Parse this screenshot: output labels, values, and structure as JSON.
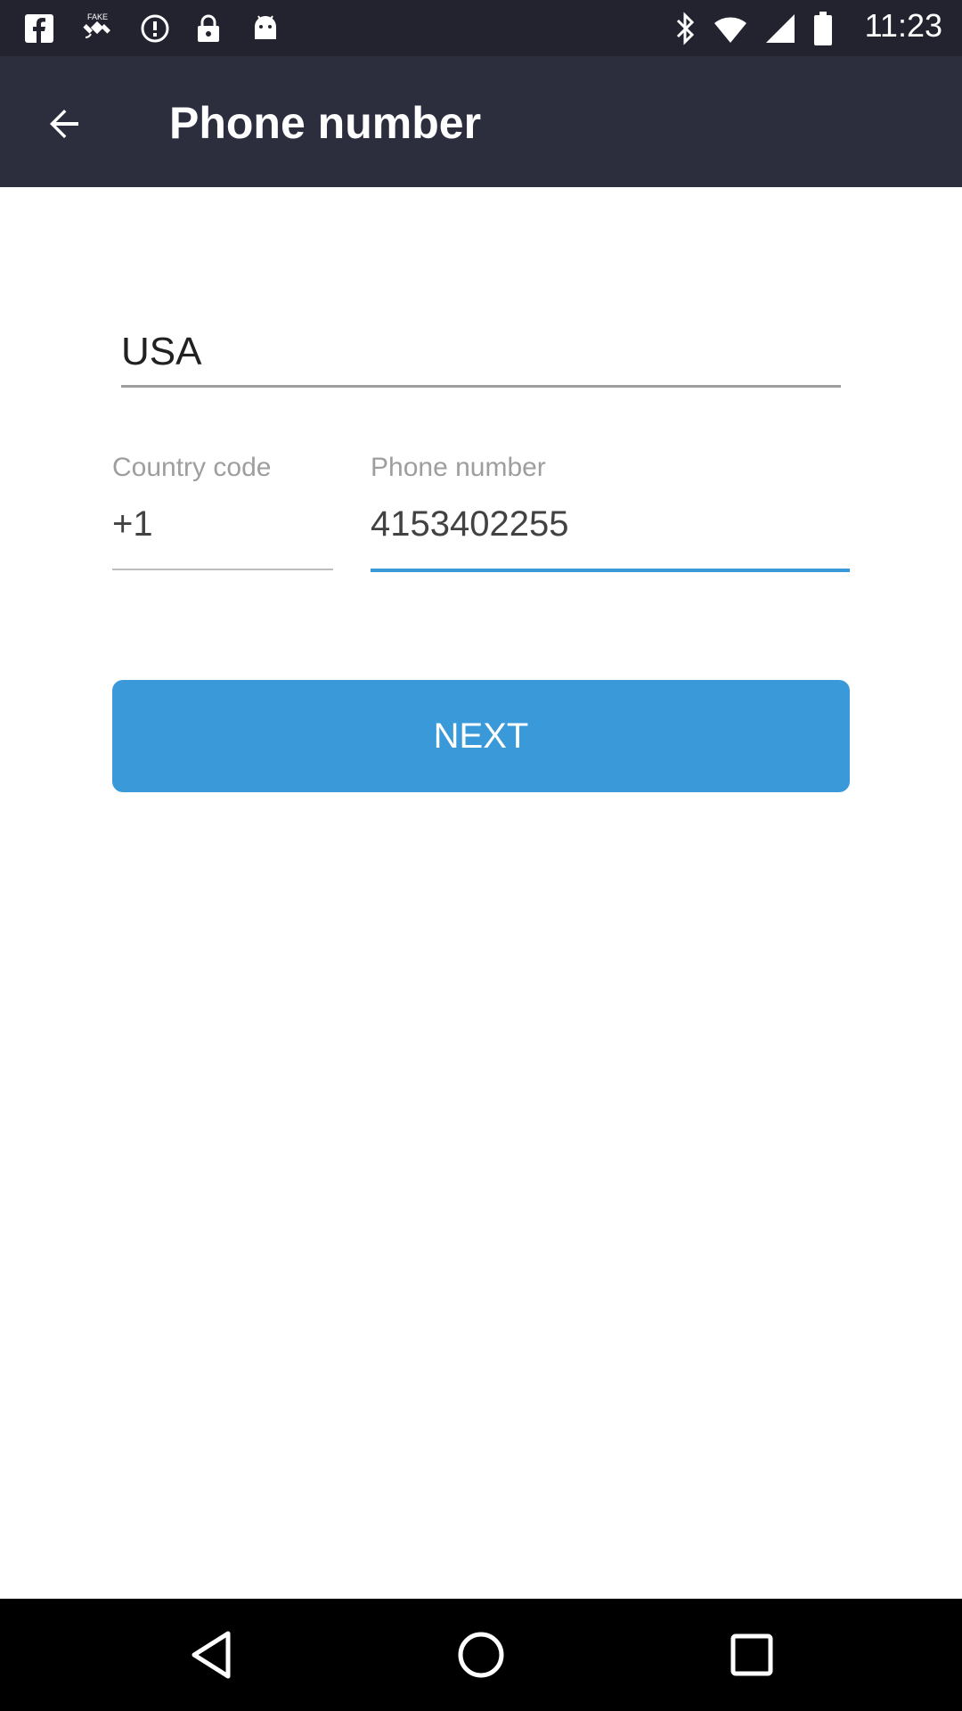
{
  "status_bar": {
    "time": "11:23",
    "icons": [
      "facebook-icon",
      "fake-gps-icon",
      "data-saver-icon",
      "lock-icon",
      "android-icon",
      "bluetooth-icon",
      "wifi-icon",
      "signal-icon",
      "battery-icon"
    ],
    "fake_label": "FAKE"
  },
  "app_bar": {
    "title": "Phone number"
  },
  "form": {
    "country_value": "USA",
    "country_code_label": "Country code",
    "country_code_value": "+1",
    "phone_label": "Phone number",
    "phone_value": "4153402255"
  },
  "next_button": {
    "label": "NEXT"
  },
  "colors": {
    "status_bar": "#22232f",
    "app_bar": "#2c2e3e",
    "accent": "#3a9ad9"
  }
}
